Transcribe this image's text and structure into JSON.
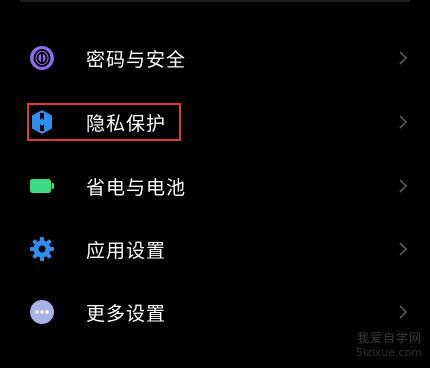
{
  "colors": {
    "background": "#000000",
    "text": "#ffffff",
    "chevron": "#5a5a5e",
    "highlight_box": "#e0353a",
    "password_icon": "#8c6cf0",
    "privacy_icon": "#2f8ff0",
    "battery_icon": "#3ddc84",
    "apps_icon": "#2f8ff0",
    "more_icon": "#a6b2e8"
  },
  "settings": {
    "items": [
      {
        "label": "密码与安全",
        "icon": "fingerprint-icon"
      },
      {
        "label": "隐私保护",
        "icon": "privacy-shield-icon"
      },
      {
        "label": "省电与电池",
        "icon": "battery-icon"
      },
      {
        "label": "应用设置",
        "icon": "gear-icon"
      },
      {
        "label": "更多设置",
        "icon": "more-dots-icon"
      }
    ]
  },
  "watermark": {
    "line1": "我爱自学网",
    "line2": "5izixue.com"
  }
}
